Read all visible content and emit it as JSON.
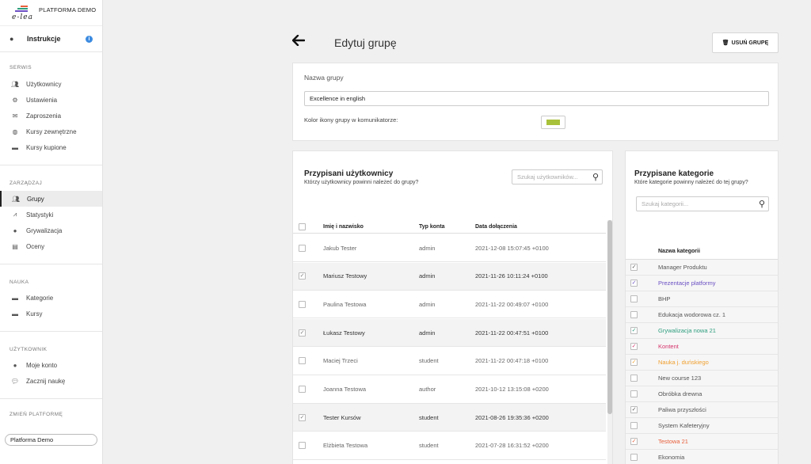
{
  "brand": {
    "logo_text": "e-lea",
    "platform_name": "PLATFORMA DEMO"
  },
  "sidebar": {
    "instructions": "Instrukcje",
    "sections": [
      {
        "title": "SERWIS",
        "items": [
          {
            "label": "Użytkownicy",
            "icon": "users-icon"
          },
          {
            "label": "Ustawienia",
            "icon": "gear-icon"
          },
          {
            "label": "Zaproszenia",
            "icon": "envelope-icon"
          },
          {
            "label": "Kursy zewnętrzne",
            "icon": "globe-icon"
          },
          {
            "label": "Kursy kupione",
            "icon": "folder-icon"
          }
        ]
      },
      {
        "title": "ZARZĄDZAJ",
        "items": [
          {
            "label": "Grupy",
            "icon": "users-icon",
            "active": true
          },
          {
            "label": "Statystyki",
            "icon": "chart-icon"
          },
          {
            "label": "Grywalizacja",
            "icon": "user-icon"
          },
          {
            "label": "Oceny",
            "icon": "list-icon"
          }
        ]
      },
      {
        "title": "NAUKA",
        "items": [
          {
            "label": "Kategorie",
            "icon": "folder-icon"
          },
          {
            "label": "Kursy",
            "icon": "folder-icon"
          }
        ]
      },
      {
        "title": "UŻYTKOWNIK",
        "items": [
          {
            "label": "Moje konto",
            "icon": "user-icon"
          },
          {
            "label": "Zacznij naukę",
            "icon": "chat-icon"
          }
        ]
      }
    ],
    "platform_section_title": "ZMIEŃ PLATFORMĘ",
    "platform_value": "Platforma Demo"
  },
  "page": {
    "title": "Edytuj grupę",
    "delete_button": "USUŃ GRUPĘ"
  },
  "group": {
    "name_label": "Nazwa grupy",
    "name_value": "Excellence in english",
    "color_label": "Kolor ikony grupy w komunikatorze:",
    "color": "#a8c13a"
  },
  "users": {
    "title": "Przypisani użytkownicy",
    "subtitle": "Którzy użytkownicy powinni należeć do grupy?",
    "search_placeholder": "Szukaj użytkowników...",
    "columns": [
      "Imię i nazwisko",
      "Typ konta",
      "Data dołączenia"
    ],
    "rows": [
      {
        "name": "Jakub Tester",
        "type": "admin",
        "date": "2021-12-08 15:07:45 +0100",
        "selected": false
      },
      {
        "name": "Mariusz Testowy",
        "type": "admin",
        "date": "2021-11-26 10:11:24 +0100",
        "selected": true
      },
      {
        "name": "Paulina Testowa",
        "type": "admin",
        "date": "2021-11-22 00:49:07 +0100",
        "selected": false
      },
      {
        "name": "Łukasz Testowy",
        "type": "admin",
        "date": "2021-11-22 00:47:51 +0100",
        "selected": true
      },
      {
        "name": "Maciej Trzeci",
        "type": "student",
        "date": "2021-11-22 00:47:18 +0100",
        "selected": false
      },
      {
        "name": "Joanna Testowa",
        "type": "author",
        "date": "2021-10-12 13:15:08 +0200",
        "selected": false
      },
      {
        "name": "Tester Kursów",
        "type": "student",
        "date": "2021-08-26 19:35:36 +0200",
        "selected": true
      },
      {
        "name": "Elżbieta Testowa",
        "type": "student",
        "date": "2021-07-28 16:31:52 +0200",
        "selected": false
      }
    ]
  },
  "categories": {
    "title": "Przypisane kategorie",
    "subtitle": "Które kategorie powinny należeć do tej grupy?",
    "search_placeholder": "Szukaj kategorii...",
    "column": "Nazwa kategorii",
    "rows": [
      {
        "name": "Manager Produktu",
        "checked": true,
        "color": "#555555"
      },
      {
        "name": "Prezentacje platformy",
        "checked": true,
        "color": "#6a4fc2"
      },
      {
        "name": "BHP",
        "checked": false,
        "color": "#555555"
      },
      {
        "name": "Edukacja wodorowa cz. 1",
        "checked": false,
        "color": "#555555"
      },
      {
        "name": "Grywalizacja nowa 21",
        "checked": true,
        "color": "#2e9e7e"
      },
      {
        "name": "Kontent",
        "checked": true,
        "color": "#d6336c"
      },
      {
        "name": "Nauka j. duńskiego",
        "checked": true,
        "color": "#f0a030"
      },
      {
        "name": "New course 123",
        "checked": false,
        "color": "#555555"
      },
      {
        "name": "Obróbka drewna",
        "checked": false,
        "color": "#555555"
      },
      {
        "name": "Paliwa przyszłości",
        "checked": true,
        "color": "#555555"
      },
      {
        "name": "System Kafeteryjny",
        "checked": false,
        "color": "#555555"
      },
      {
        "name": "Testowa 21",
        "checked": true,
        "color": "#e8603c"
      },
      {
        "name": "Ekonomia",
        "checked": false,
        "color": "#555555"
      }
    ]
  }
}
